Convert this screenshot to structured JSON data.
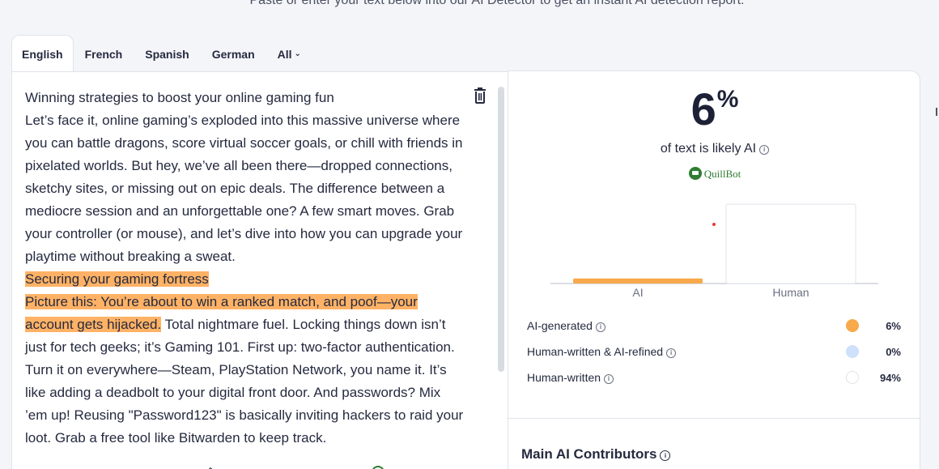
{
  "header": {
    "caption": "Paste or enter your text below into our AI Detector to get an instant AI detection report."
  },
  "tabs": [
    {
      "label": "English",
      "active": true
    },
    {
      "label": "French"
    },
    {
      "label": "Spanish"
    },
    {
      "label": "German"
    },
    {
      "label": "All"
    }
  ],
  "editor": {
    "lines": [
      "Winning strategies to boost your online gaming fun",
      "Let’s face it, online gaming’s exploded into this massive universe where",
      "you can battle dragons, score virtual soccer goals, or chill with friends in",
      "pixelated worlds. But hey, we’ve all been there—dropped connections,",
      "sketchy sites, or missing out on epic deals. The difference between a",
      "mediocre session and an unforgettable one? A few smart moves. Grab",
      "your controller (or mouse), and let’s dive into how you can upgrade your",
      "playtime without breaking a sweat.",
      "Securing your gaming fortress",
      "Picture this: You’re about to win a ranked match, and poof—your",
      "account gets hijacked.",
      " Total nightmare fuel. Locking things down isn’t",
      "just for tech geeks; it’s Gaming 101. First up: two-factor authentication.",
      "Turn it on everywhere—Steam, PlayStation Network, you name it. It’s",
      "like adding a deadbolt to your digital front door. And passwords? Mix",
      "’em up! Reusing \"Password123\" is basically inviting hackers to raid your",
      "loot. Grab a free tool like Bitwarden to keep track."
    ]
  },
  "result": {
    "percent": "6",
    "percent_symbol": "%",
    "likely_label": "of text is likely AI",
    "info_glyph": "i",
    "brand": "QuillBot",
    "legend": [
      {
        "label": "AI-generated",
        "value": "6%",
        "color": "#f7a94b"
      },
      {
        "label": "Human-written & AI-refined",
        "value": "0%",
        "color": "#cfe0fb"
      },
      {
        "label": "Human-written",
        "value": "94%",
        "color": "#ffffff"
      }
    ],
    "contributors_title": "Main AI Contributors"
  },
  "chart_data": {
    "type": "bar",
    "categories": [
      "AI",
      "Human"
    ],
    "values": [
      6,
      94
    ],
    "ylim": [
      0,
      94
    ],
    "colors": [
      "#f7a94b",
      "#ffffff"
    ]
  }
}
